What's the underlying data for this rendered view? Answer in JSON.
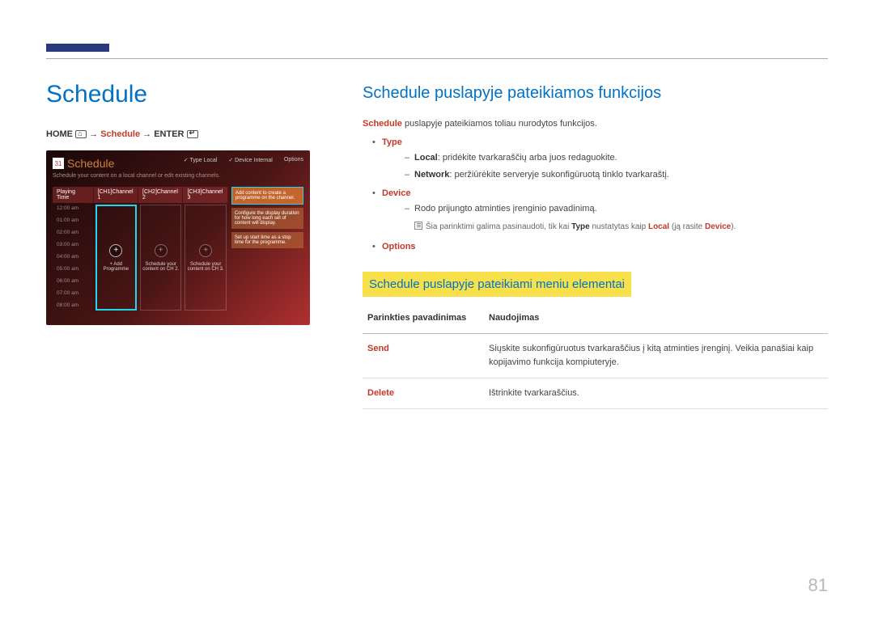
{
  "page_number": "81",
  "title": "Schedule",
  "breadcrumb": {
    "home": "HOME",
    "schedule": "Schedule",
    "enter": "ENTER",
    "sep": "→"
  },
  "mock": {
    "cal_icon_text": "31",
    "title": "Schedule",
    "subtitle": "Schedule your content on a local channel or edit existing channels.",
    "top_type_label": "Type",
    "top_type_value": "Local",
    "top_device_label": "Device",
    "top_device_value": "Internal",
    "top_options": "Options",
    "playing_time_hdr": "Playing Time",
    "times": [
      "12:00 am",
      "01:00 am",
      "02:00 am",
      "03:00 am",
      "04:00 am",
      "05:00 am",
      "06:00 am",
      "07:00 am",
      "08:00 am"
    ],
    "channels": [
      {
        "hdr": "[CH1]Channel 1",
        "plus_style": "sel",
        "label": "+ Add Programme"
      },
      {
        "hdr": "[CH2]Channel 2",
        "plus_style": "dim",
        "label": "Schedule your content on CH 2."
      },
      {
        "hdr": "[CH3]Channel 3",
        "plus_style": "dim",
        "label": "Schedule your content on CH 3."
      }
    ],
    "info_boxes": [
      "Add content to create a programme on the channel.",
      "Configure the display duration for how long each set of content will display.",
      "Set up start time as a stop time for the programme."
    ]
  },
  "section1_title": "Schedule puslapyje pateikiamos funkcijos",
  "intro": {
    "prefix": "Schedule",
    "rest": " puslapyje pateikiamos toliau nurodytos funkcijos."
  },
  "features": {
    "type": {
      "label": "Type",
      "local_label": "Local",
      "local_text": ": pridėkite tvarkaraščių arba juos redaguokite.",
      "network_label": "Network",
      "network_text": ": peržiūrėkite serveryje sukonfigūruotą tinklo tvarkaraštį."
    },
    "device": {
      "label": "Device",
      "line1": "Rodo prijungto atminties įrenginio pavadinimą.",
      "note_pre": "Šia parinktimi galima pasinaudoti, tik kai ",
      "note_type": "Type",
      "note_mid": " nustatytas kaip ",
      "note_local": "Local",
      "note_mid2": " (ją rasite ",
      "note_device": "Device",
      "note_end": ")."
    },
    "options_label": "Options"
  },
  "section2_title": "Schedule puslapyje pateikiami meniu elementai",
  "table": {
    "col1": "Parinkties pavadinimas",
    "col2": "Naudojimas",
    "rows": [
      {
        "name": "Send",
        "desc": "Siųskite sukonfigūruotus tvarkaraščius į kitą atminties įrenginį. Veikia panašiai kaip kopijavimo funkcija kompiuteryje."
      },
      {
        "name": "Delete",
        "desc": "Ištrinkite tvarkaraščius."
      }
    ]
  }
}
